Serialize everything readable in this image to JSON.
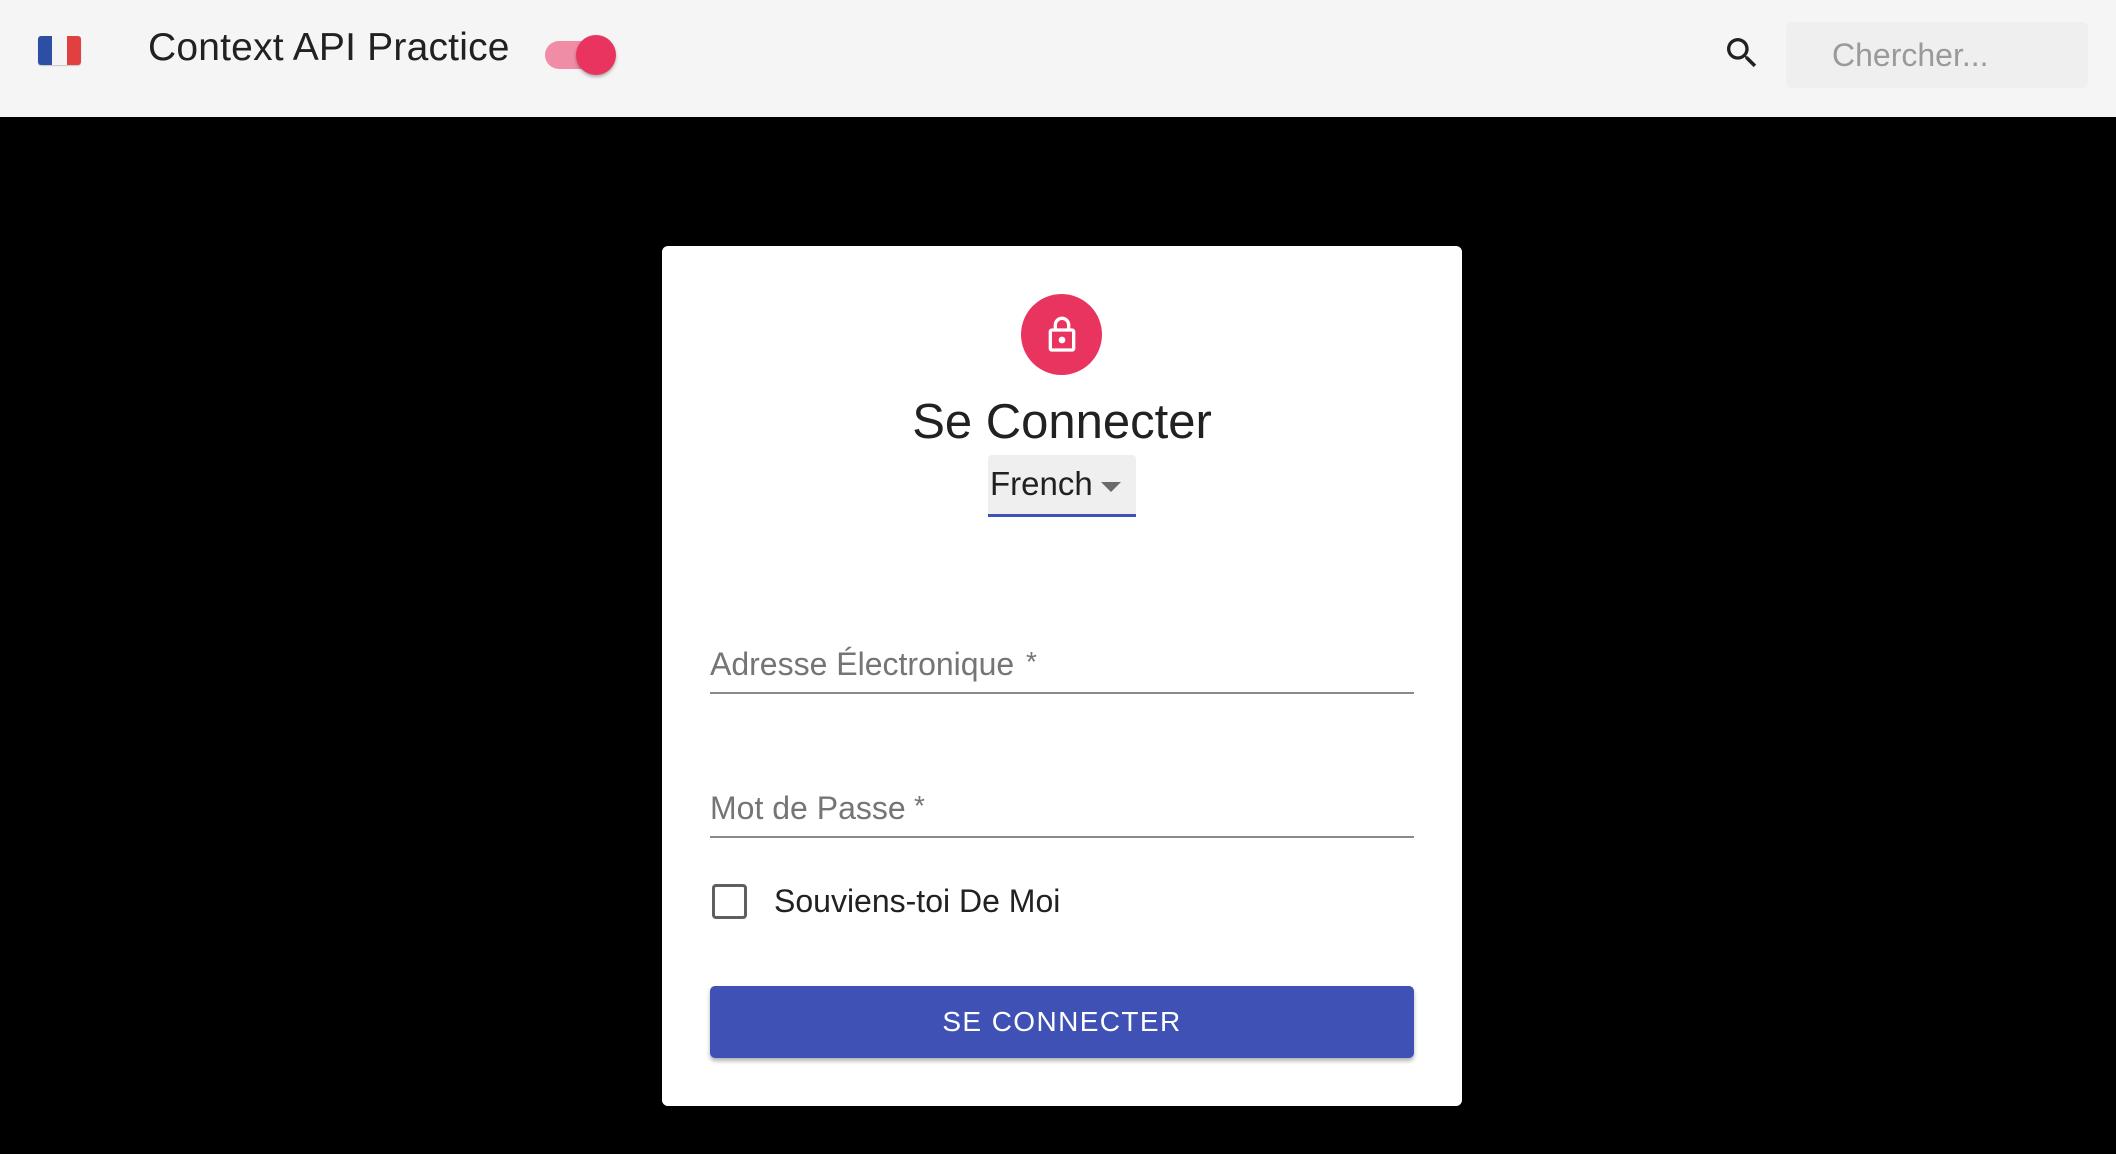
{
  "appbar": {
    "flag_icon": "france-flag-icon",
    "title": "Context API Practice",
    "theme_toggle": {
      "state": "on",
      "color": "#e8345e"
    },
    "search": {
      "icon": "search-icon",
      "placeholder": "Chercher..."
    }
  },
  "login": {
    "icon": "lock-icon",
    "title": "Se Connecter",
    "language_select": {
      "value": "French"
    },
    "email": {
      "label": "Adresse Électronique",
      "required_mark": "*"
    },
    "password": {
      "label": "Mot de Passe",
      "required_mark": "*"
    },
    "remember": {
      "label": "Souviens-toi De Moi",
      "checked": false
    },
    "submit_label": "SE CONNECTER"
  },
  "colors": {
    "primary": "#3f51b5",
    "secondary": "#e8345e",
    "background": "#000000",
    "appbar": "#f5f5f5"
  }
}
